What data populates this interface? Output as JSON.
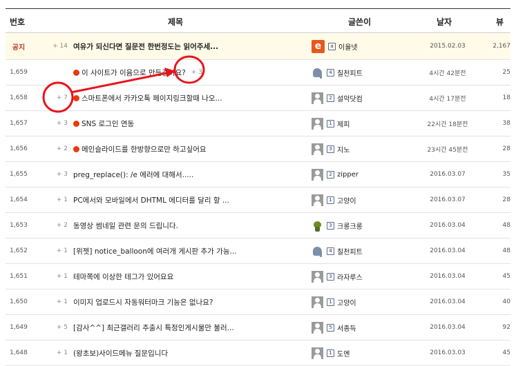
{
  "header": {
    "num": "번호",
    "title": "제목",
    "author": "글쓴이",
    "date": "날자",
    "views": "뷰"
  },
  "notice": {
    "num": "공지",
    "comments": "+ 14",
    "title": "여유가 되신다면 질문전 한번정도는 읽어주세...",
    "level": "a",
    "author": "이율넷",
    "date": "2015.02.03",
    "views": "2,167",
    "avatar": "logo",
    "logo_letter": "e"
  },
  "rows": [
    {
      "num": "1,659",
      "comments": "",
      "title": "이 사이트가 이윰으로 만든걸까요?",
      "title_comment": "+ 3",
      "dot": true,
      "level": "4",
      "author": "칠천피트",
      "date": "4시간 42분전",
      "views": "25",
      "avatar": "elephant"
    },
    {
      "num": "1,658",
      "comments": "+ 7",
      "title": "스마트폰에서 카카오톡 페이지링크할때 나오...",
      "title_comment": "",
      "dot": true,
      "level": "2",
      "author": "설악닷컴",
      "date": "4시간 17분전",
      "views": "18",
      "avatar": "person"
    },
    {
      "num": "1,657",
      "comments": "+ 3",
      "title": "SNS 로그인 연동",
      "title_comment": "",
      "dot": true,
      "level": "1",
      "author": "제피",
      "date": "22시간 18분전",
      "views": "38",
      "avatar": "person"
    },
    {
      "num": "1,656",
      "comments": "+ 2",
      "title": "메인슬라이드를 한방향으로만 하고싶어요",
      "title_comment": "",
      "dot": true,
      "level": "3",
      "author": "지노",
      "date": "23시간 45분전",
      "views": "28",
      "avatar": "person"
    },
    {
      "num": "1,655",
      "comments": "+ 3",
      "title": "preg_replace(): /e 에러에 대해서.....",
      "title_comment": "",
      "dot": false,
      "level": "2",
      "author": "zipper",
      "date": "2016.03.07",
      "views": "35",
      "avatar": "person"
    },
    {
      "num": "1,654",
      "comments": "+ 1",
      "title": "PC에서와 모바일에서 DHTML 에디터를 달리 할 ...",
      "title_comment": "",
      "dot": false,
      "level": "1",
      "author": "고양이",
      "date": "2016.03.07",
      "views": "28",
      "avatar": "person"
    },
    {
      "num": "1,653",
      "comments": "+ 2",
      "title": "동영상 썸네일 관련 문의 드립니다.",
      "title_comment": "",
      "dot": false,
      "level": "3",
      "author": "크롱크롱",
      "date": "2016.03.04",
      "views": "48",
      "avatar": "frog"
    },
    {
      "num": "1,652",
      "comments": "+ 1",
      "title": "[위젯] notice_balloon에 여러개 게시판 추가 가능...",
      "title_comment": "",
      "dot": false,
      "level": "4",
      "author": "칠천피트",
      "date": "2016.03.04",
      "views": "48",
      "avatar": "elephant"
    },
    {
      "num": "1,651",
      "comments": "+ 1",
      "title": "테마쪽에 이상한 테그가 있어요요",
      "title_comment": "",
      "dot": false,
      "level": "3",
      "author": "라자루스",
      "date": "2016.03.04",
      "views": "45",
      "avatar": "person"
    },
    {
      "num": "1,650",
      "comments": "+ 1",
      "title": "이미지 업로드시 자동워터마크 기능은 없나요?",
      "title_comment": "",
      "dot": false,
      "level": "1",
      "author": "고양이",
      "date": "2016.03.04",
      "views": "40",
      "avatar": "person"
    },
    {
      "num": "1,649",
      "comments": "+ 5",
      "title": "[감사^^] 최근갤러리 추출시 특정인게시물만 불러...",
      "title_comment": "",
      "dot": false,
      "level": "5",
      "author": "서종득",
      "date": "2016.03.04",
      "views": "92",
      "avatar": "person"
    },
    {
      "num": "1,648",
      "comments": "+ 1",
      "title": "(왕초보)사이드메뉴 질문입니다",
      "title_comment": "",
      "dot": false,
      "level": "1",
      "author": "도멘",
      "date": "2016.03.03",
      "views": "45",
      "avatar": "person"
    }
  ],
  "colors": {
    "new_dot": "#e63b0e",
    "annotation": "#e8141c",
    "notice_bg": "#fffbe8"
  }
}
